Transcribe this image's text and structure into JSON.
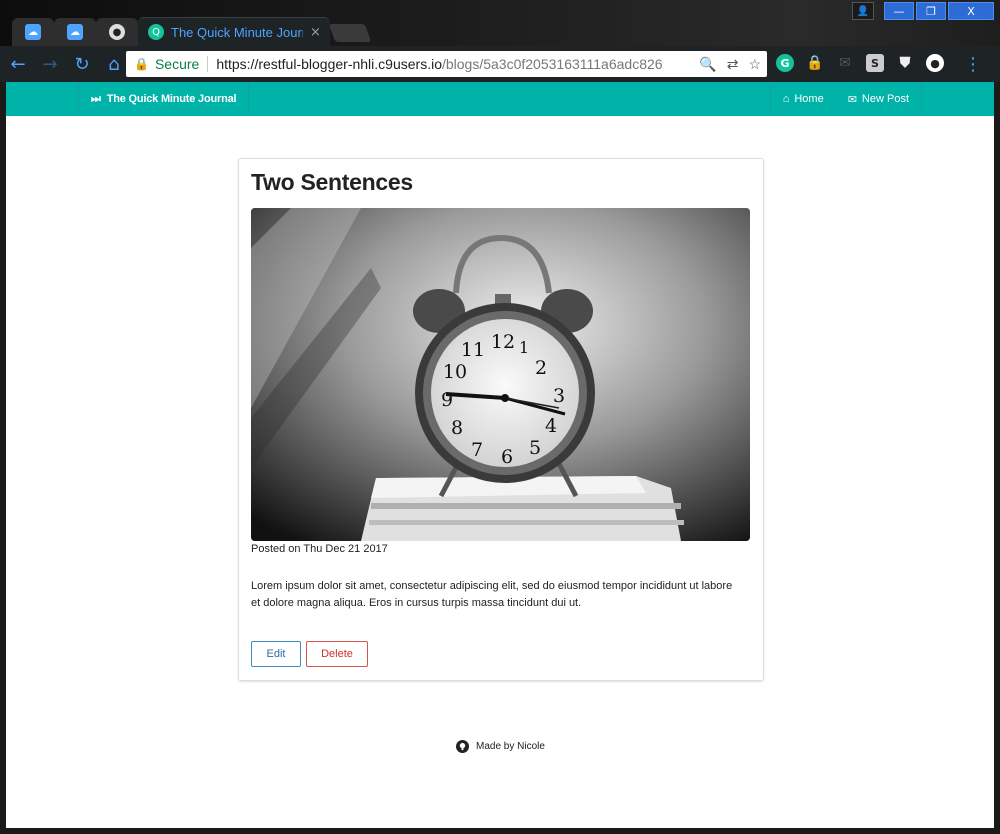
{
  "browser": {
    "active_tab_title": "The Quick Minute Journal",
    "tab_close": "×",
    "window_controls": {
      "minimize": "—",
      "maximize": "❐",
      "close": "X"
    },
    "omnibox": {
      "secure_label": "Secure",
      "url_host": "https://restful-blogger-nhli.c9users.io",
      "url_path": "/blogs/5a3c0f2053163111a6adc826"
    },
    "extensions": [
      {
        "name": "grammarly-icon",
        "glyph": "G",
        "color": "#15c39a"
      },
      {
        "name": "lastpass-icon",
        "glyph": "🔒",
        "color": "#d32d27"
      },
      {
        "name": "mail-icon",
        "glyph": "✉",
        "color": "#444"
      },
      {
        "name": "s-extension-icon",
        "glyph": "S",
        "color": "#bbb"
      },
      {
        "name": "shield-extension-icon",
        "glyph": "⛊",
        "color": "#1e2326"
      },
      {
        "name": "circle-extension-icon",
        "glyph": "●",
        "color": "#fff"
      }
    ]
  },
  "site": {
    "brand": "The Quick Minute Journal",
    "nav": {
      "home": "Home",
      "new_post": "New Post"
    },
    "accent_color": "#00b3a9"
  },
  "post": {
    "title": "Two Sentences",
    "image_alt": "alarm clock photo",
    "posted_prefix": "Posted on ",
    "posted_date": "Thu Dec 21 2017",
    "body": "Lorem ipsum dolor sit amet, consectetur adipiscing elit, sed do eiusmod tempor incididunt ut labore et dolore magna aliqua. Eros in cursus turpis massa tincidunt dui ut.",
    "edit_label": "Edit",
    "delete_label": "Delete"
  },
  "footer": {
    "credit": "Made by Nicole"
  }
}
